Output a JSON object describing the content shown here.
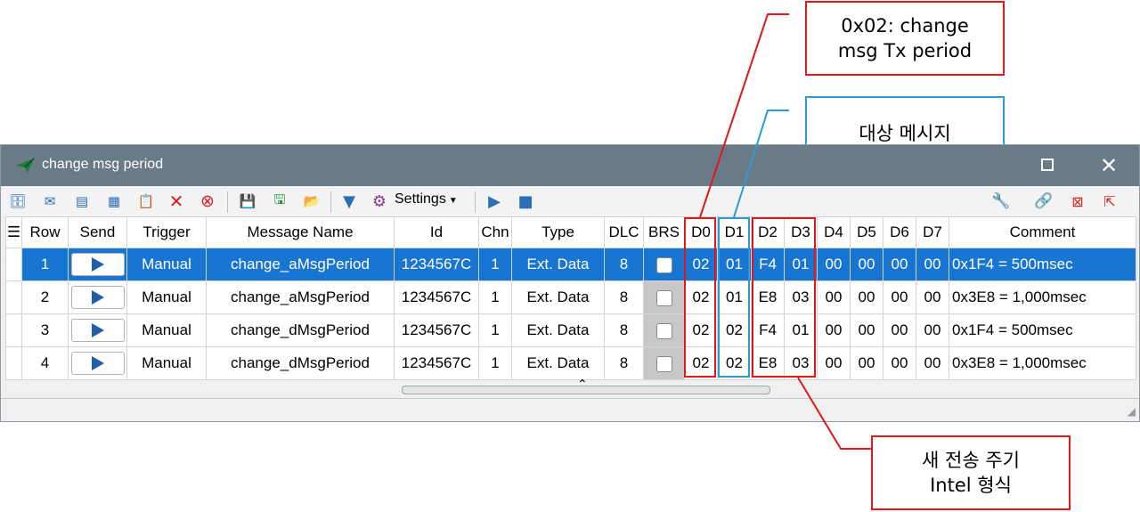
{
  "window": {
    "title": "change msg period"
  },
  "toolbar": {
    "settings_label": "Settings"
  },
  "table": {
    "headers": [
      "Row",
      "Send",
      "Trigger",
      "Message Name",
      "Id",
      "Chn",
      "Type",
      "DLC",
      "BRS",
      "D0",
      "D1",
      "D2",
      "D3",
      "D4",
      "D5",
      "D6",
      "D7",
      "Comment"
    ],
    "rows": [
      {
        "row": "1",
        "trigger": "Manual",
        "name": "change_aMsgPeriod",
        "id": "1234567C",
        "chn": "1",
        "type": "Ext. Data",
        "dlc": "8",
        "d": [
          "02",
          "01",
          "F4",
          "01",
          "00",
          "00",
          "00",
          "00"
        ],
        "comment": "0x1F4 = 500msec"
      },
      {
        "row": "2",
        "trigger": "Manual",
        "name": "change_aMsgPeriod",
        "id": "1234567C",
        "chn": "1",
        "type": "Ext. Data",
        "dlc": "8",
        "d": [
          "02",
          "01",
          "E8",
          "03",
          "00",
          "00",
          "00",
          "00"
        ],
        "comment": "0x3E8 = 1,000msec"
      },
      {
        "row": "3",
        "trigger": "Manual",
        "name": "change_dMsgPeriod",
        "id": "1234567C",
        "chn": "1",
        "type": "Ext. Data",
        "dlc": "8",
        "d": [
          "02",
          "02",
          "F4",
          "01",
          "00",
          "00",
          "00",
          "00"
        ],
        "comment": "0x1F4 = 500msec"
      },
      {
        "row": "4",
        "trigger": "Manual",
        "name": "change_dMsgPeriod",
        "id": "1234567C",
        "chn": "1",
        "type": "Ext. Data",
        "dlc": "8",
        "d": [
          "02",
          "02",
          "E8",
          "03",
          "00",
          "00",
          "00",
          "00"
        ],
        "comment": "0x3E8 = 1,000msec"
      }
    ]
  },
  "annotations": {
    "d0": {
      "line1": "0x02: change",
      "line2": "msg Tx period",
      "color": "#e0171b"
    },
    "d1": {
      "line1": "대상 메시지",
      "color": "#2b9bd1"
    },
    "d2d3": {
      "line1": "새 전송 주기",
      "line2": "Intel 형식",
      "color": "#e0171b"
    }
  },
  "colors": {
    "selected_row": "#1876d2",
    "titlebar": "#697b87",
    "send_icon": "#1f5fa8"
  }
}
